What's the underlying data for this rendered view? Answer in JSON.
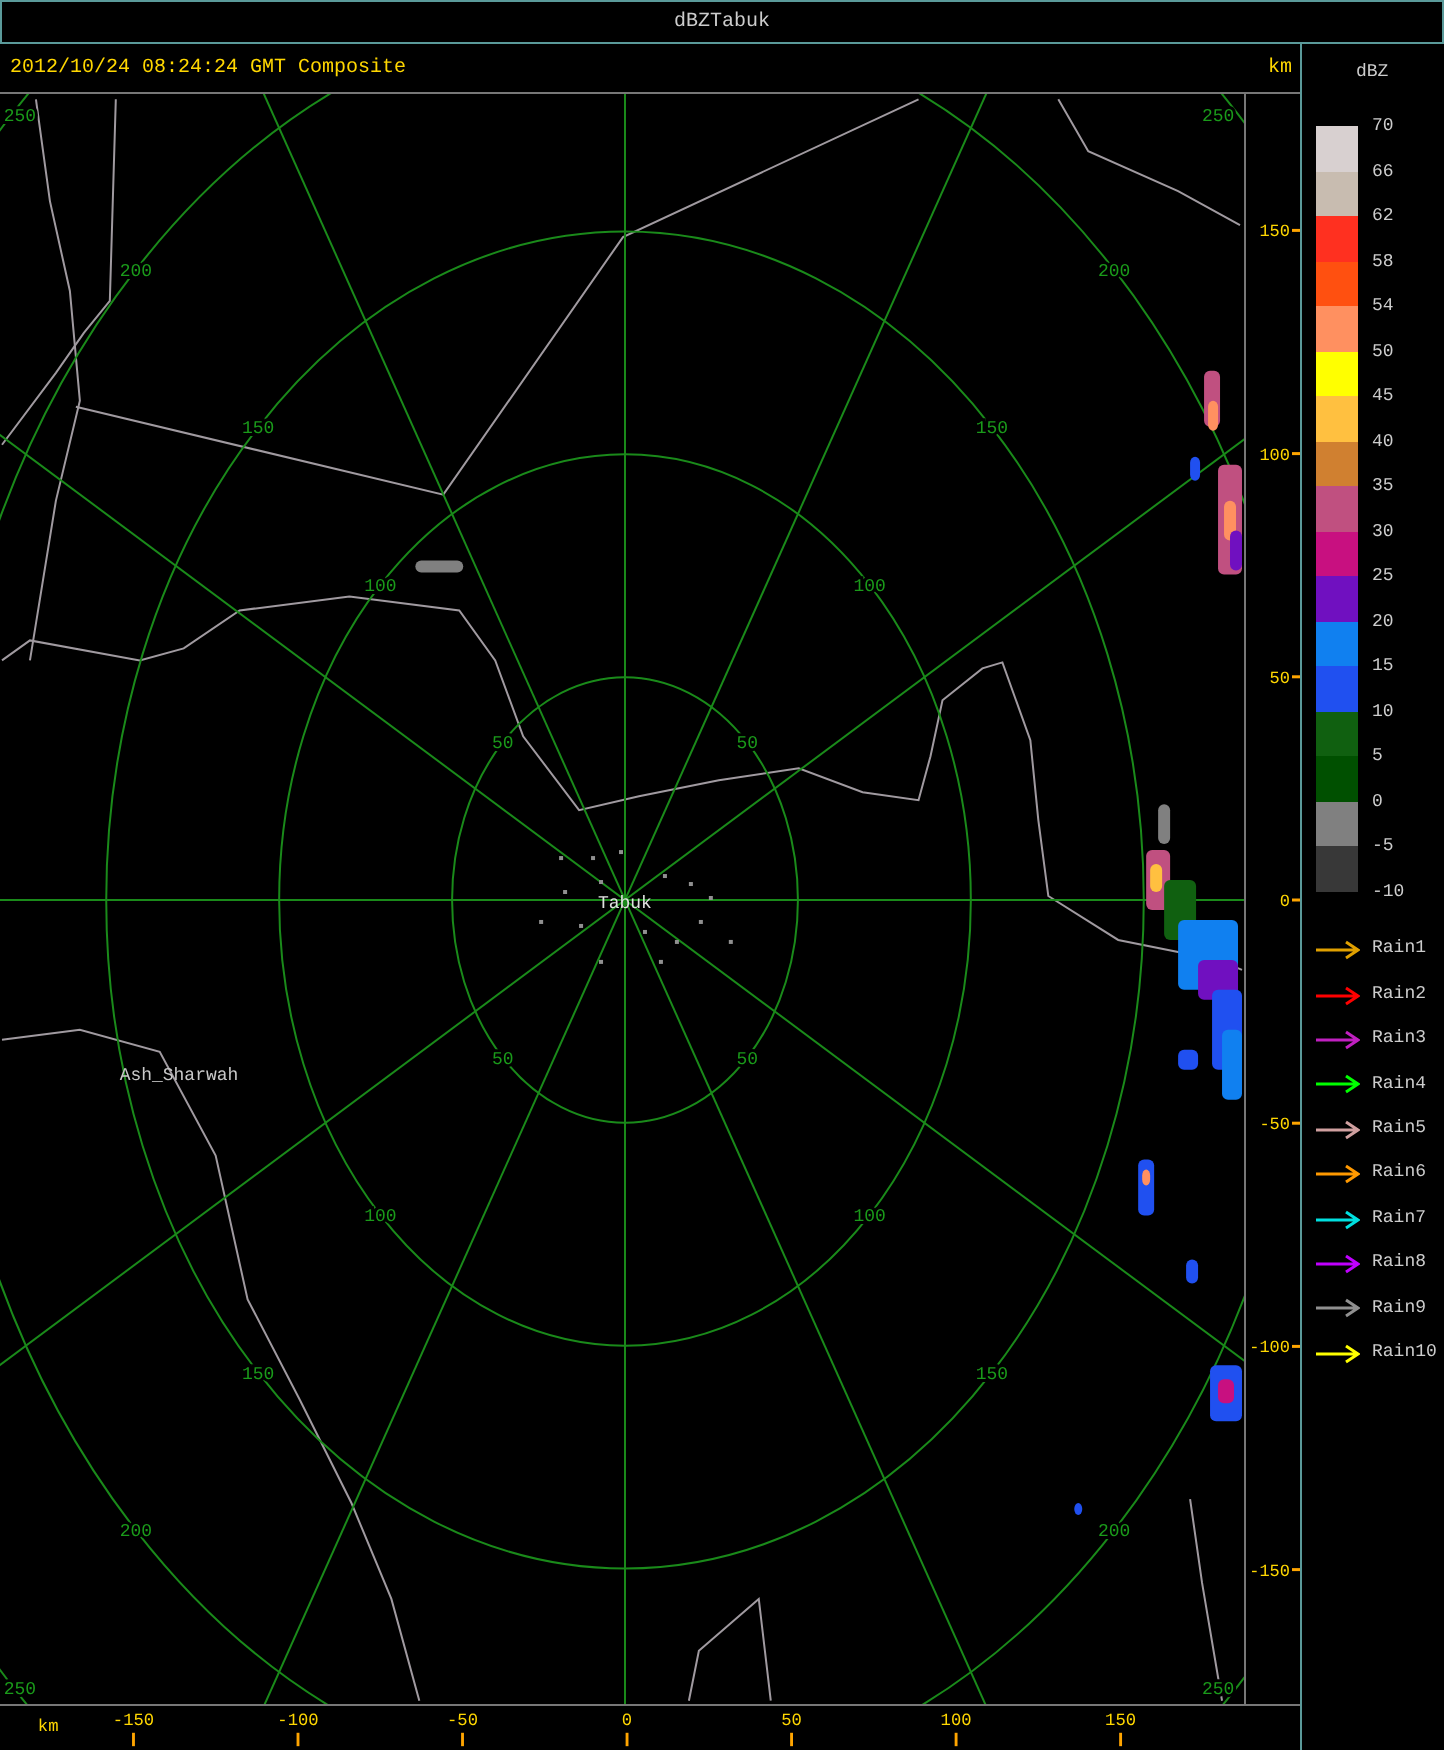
{
  "window": {
    "title": "dBZTabuk"
  },
  "header": {
    "timestamp": "2012/10/24 08:24:24 GMT Composite",
    "unit": "km"
  },
  "plot": {
    "range_rings": [
      {
        "labels": [
          "50",
          "50",
          "50",
          "50"
        ]
      },
      {
        "labels": [
          "100",
          "100",
          "100",
          "100"
        ]
      },
      {
        "labels": [
          "150",
          "150",
          "150",
          "150"
        ]
      },
      {
        "labels": [
          "200",
          "200",
          "200",
          "200"
        ]
      },
      {
        "labels": [
          "250",
          "250",
          "250",
          "250"
        ]
      }
    ],
    "places": [
      {
        "name": "Tabuk",
        "kind": "station"
      },
      {
        "name": "Ash_Sharwah",
        "kind": "town"
      }
    ]
  },
  "y_axis": {
    "ticks": [
      "150",
      "100",
      "50",
      "0",
      "-50",
      "-100",
      "-150"
    ]
  },
  "x_axis": {
    "unit": "km",
    "ticks": [
      "-150",
      "-100",
      "-50",
      "0",
      "50",
      "100",
      "150"
    ]
  },
  "legend": {
    "unit": "dBZ",
    "labels": [
      "70",
      "66",
      "62",
      "58",
      "54",
      "50",
      "45",
      "40",
      "35",
      "30",
      "25",
      "20",
      "15",
      "10",
      "5",
      "0",
      "-5",
      "-10"
    ],
    "segments": [
      {
        "color": "#d8d0d0"
      },
      {
        "color": "#c8bcb0"
      },
      {
        "color": "#ff3020"
      },
      {
        "color": "#ff5010"
      },
      {
        "color": "#ff9060"
      },
      {
        "color": "#ffff00"
      },
      {
        "color": "#ffc040"
      },
      {
        "color": "#d08030"
      },
      {
        "color": "#c05080"
      },
      {
        "color": "#c81080"
      },
      {
        "color": "#7010c0"
      },
      {
        "color": "#1080f0"
      },
      {
        "color": "#2050f0"
      },
      {
        "color": "#106010"
      },
      {
        "color": "#005000"
      },
      {
        "color": "#808080"
      },
      {
        "color": "#383838"
      }
    ]
  },
  "rain_tracks": [
    {
      "label": "Rain1",
      "color": "#e0a000"
    },
    {
      "label": "Rain2",
      "color": "#ff0000"
    },
    {
      "label": "Rain3",
      "color": "#c020c0"
    },
    {
      "label": "Rain4",
      "color": "#00ff00"
    },
    {
      "label": "Rain5",
      "color": "#d0a0a0"
    },
    {
      "label": "Rain6",
      "color": "#ff9900"
    },
    {
      "label": "Rain7",
      "color": "#00e0e0"
    },
    {
      "label": "Rain8",
      "color": "#c000ff"
    },
    {
      "label": "Rain9",
      "color": "#909090"
    },
    {
      "label": "Rain10",
      "color": "#ffff00"
    }
  ]
}
